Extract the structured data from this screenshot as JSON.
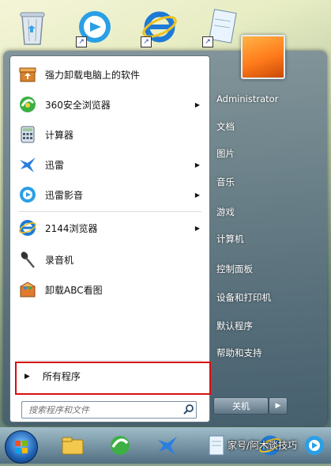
{
  "programs": [
    {
      "label": "强力卸载电脑上的软件",
      "icon": "uninstall-box-icon",
      "arrow": false
    },
    {
      "label": "360安全浏览器",
      "icon": "browser-360-icon",
      "arrow": true
    },
    {
      "label": "计算器",
      "icon": "calculator-icon",
      "arrow": false
    },
    {
      "label": "迅雷",
      "icon": "thunder-icon",
      "arrow": true
    },
    {
      "label": "迅雷影音",
      "icon": "thunder-player-icon",
      "arrow": true
    },
    {
      "label": "2144浏览器",
      "icon": "browser-2144-icon",
      "arrow": true
    },
    {
      "label": "录音机",
      "icon": "microphone-icon",
      "arrow": false
    },
    {
      "label": "卸载ABC看图",
      "icon": "abc-viewer-icon",
      "arrow": false
    }
  ],
  "all_programs_label": "所有程序",
  "search_placeholder": "搜索程序和文件",
  "right_items": [
    "Administrator",
    "文档",
    "图片",
    "音乐",
    "游戏",
    "计算机",
    "控制面板",
    "设备和打印机",
    "默认程序",
    "帮助和支持"
  ],
  "shutdown_label": "关机",
  "watermark": "家号/阿木谈技巧",
  "colors": {
    "highlight_box": "#d80f0f"
  }
}
